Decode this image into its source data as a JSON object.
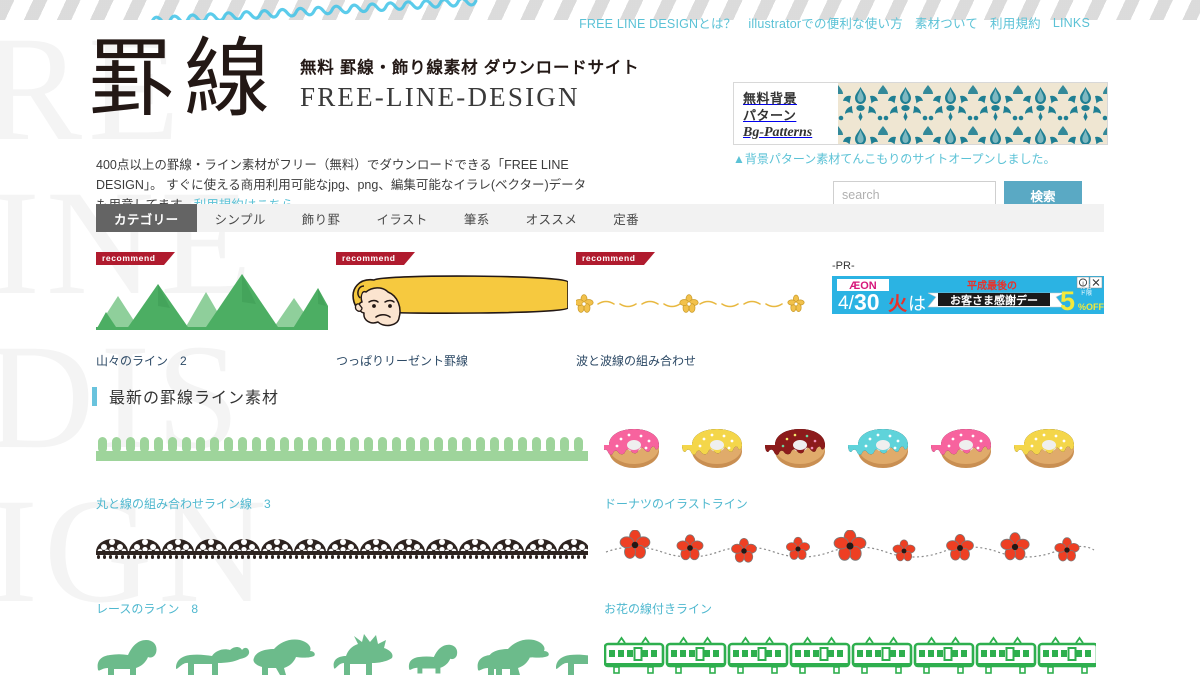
{
  "site": {
    "logo_kanji": "罫線",
    "tagline_jp": "無料 罫線・飾り線素材 ダウンロードサイト",
    "tagline_en": "FREE-LINE-DESIGN",
    "watermark_lines": [
      "RE",
      "INE",
      "DIS",
      "IGN"
    ]
  },
  "globalnav": {
    "items": [
      {
        "label": "FREE LINE DESIGNとは？"
      },
      {
        "label": "illustratorでの便利な使い方"
      },
      {
        "label": "素材ついて"
      },
      {
        "label": "利用規約"
      },
      {
        "label": "LINKS"
      }
    ]
  },
  "lead": {
    "line1": "400点以上の罫線・ライン素材がフリー（無料）でダウンロードできる「FREE LINE DESIGN」。",
    "line2": "すぐに使える商用利用可能なjpg、png、編集可能なイラレ(ベクター)データも用意してます。",
    "link": "利用規約はこちら"
  },
  "bgbanner": {
    "label1": "無料背景",
    "label2": "パターン",
    "label3": "Bg-Patterns",
    "caption": "▲背景パターン素材てんこもりのサイトオープンしました。",
    "pattern_color": "#1f7f93",
    "pattern_bg": "#efe6d2"
  },
  "search": {
    "placeholder": "search",
    "value": "",
    "button_label": "検索",
    "button_color": "#5aa9c4"
  },
  "tabs": {
    "items": [
      {
        "label": "カテゴリー",
        "active": true
      },
      {
        "label": "シンプル",
        "active": false
      },
      {
        "label": "飾り罫",
        "active": false
      },
      {
        "label": "イラスト",
        "active": false
      },
      {
        "label": "筆系",
        "active": false
      },
      {
        "label": "オススメ",
        "active": false
      },
      {
        "label": "定番",
        "active": false
      }
    ]
  },
  "recommend": {
    "badge_label": "recommend",
    "badge_color": "#b01b2e",
    "items": [
      {
        "title": "山々のライン　2",
        "art": "mountains"
      },
      {
        "title": "つっぱりリーゼント罫線",
        "art": "regent"
      },
      {
        "title": "波と波線の組み合わせ",
        "art": "wave-flower"
      }
    ]
  },
  "ad": {
    "pr_label": "-PR-",
    "brand": "ÆON",
    "date": "4/30",
    "day": "火",
    "particle": "は",
    "headline": "平成最後の",
    "banner_text": "お客さま感謝デー",
    "discount": "5",
    "discount_unit": "%OFF",
    "discount_note_1": "カ日",
    "discount_note_2": "ド限",
    "bg_color": "#2bb3e3"
  },
  "section": {
    "heading": "最新の罫線ライン素材",
    "accent_color": "#69c3dd"
  },
  "materials": {
    "items": [
      {
        "title": "丸と線の組み合わせライン線　3",
        "art": "comb-green",
        "col": 0,
        "row": 0
      },
      {
        "title": "ドーナツのイラストライン",
        "art": "donuts",
        "col": 1,
        "row": 0
      },
      {
        "title": "レースのライン　8",
        "art": "lace",
        "col": 0,
        "row": 1
      },
      {
        "title": "お花の線付きライン",
        "art": "flowers",
        "col": 1,
        "row": 1
      },
      {
        "title": "",
        "art": "dinosaurs",
        "col": 0,
        "row": 2
      },
      {
        "title": "",
        "art": "trains",
        "col": 1,
        "row": 2
      }
    ],
    "donut_colors": [
      "#f7639e",
      "#f4d64a",
      "#8c1b1b",
      "#5fd3da",
      "#f7639e",
      "#f4d64a"
    ],
    "link_color": "#4fb8cf"
  }
}
